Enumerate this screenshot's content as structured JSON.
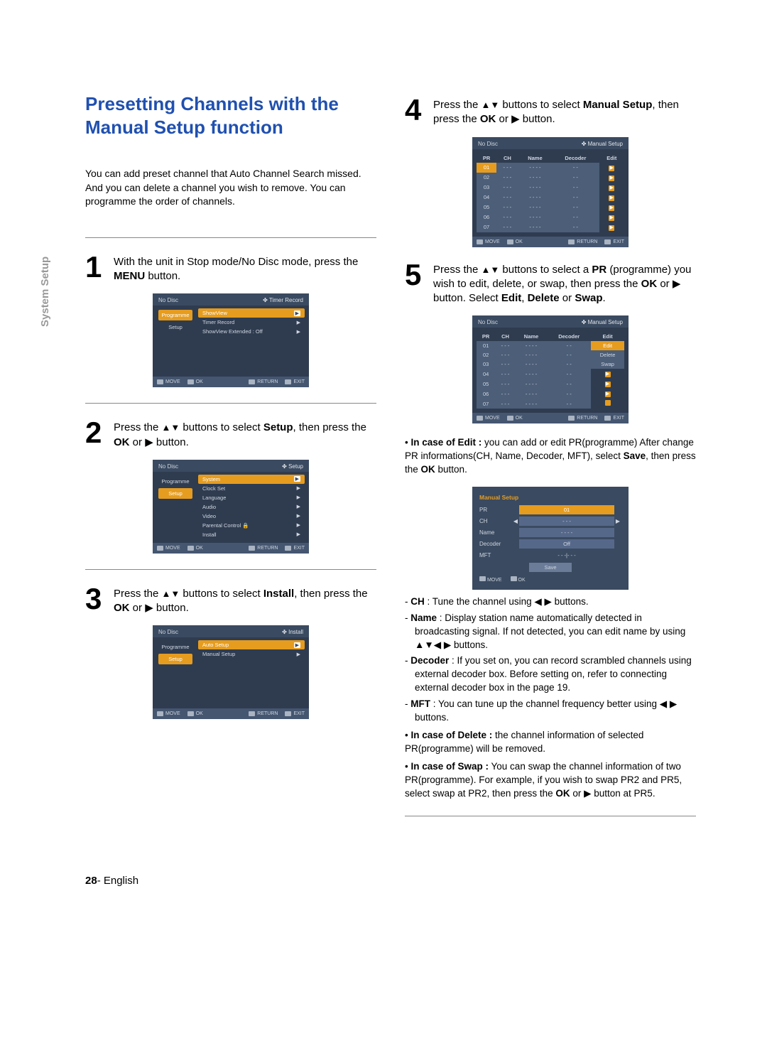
{
  "sideTab": "System Setup",
  "title": "Presetting Channels with the Manual Setup function",
  "intro": "You can add preset channel that Auto Channel Search missed. And you can delete a channel you wish to remove. You can programme the order of channels.",
  "steps": {
    "s1": {
      "num": "1",
      "pre": "With the unit in Stop mode/No Disc mode, press the ",
      "b1": "MENU",
      "post": " button."
    },
    "s2": {
      "num": "2",
      "pre": "Press the ",
      "arrows": "▲▼",
      "mid": " buttons to select ",
      "b1": "Setup",
      "mid2": ", then press the ",
      "b2": "OK",
      "or": " or ",
      "play": "▶",
      "post": " button."
    },
    "s3": {
      "num": "3",
      "pre": "Press the ",
      "arrows": "▲▼",
      "mid": " buttons to select ",
      "b1": "Install",
      "mid2": ", then press the ",
      "b2": "OK",
      "or": " or ",
      "play": "▶",
      "post": " button."
    },
    "s4": {
      "num": "4",
      "pre": "Press the ",
      "arrows": "▲▼",
      "mid": " buttons to select ",
      "b1": "Manual Setup",
      "mid2": ", then press the ",
      "b2": "OK",
      "or": " or ",
      "play": "▶",
      "post": " button."
    },
    "s5": {
      "num": "5",
      "pre": "Press the ",
      "arrows": "▲▼",
      "mid": " buttons to select a ",
      "b1": "PR",
      "mid2": " (programme) you wish to edit, delete, or swap, then press the ",
      "b2": "OK",
      "or": " or ",
      "play": "▶",
      "post": " button. Select ",
      "b3": "Edit",
      "c1": ", ",
      "b4": "Delete",
      "c2": " or ",
      "b5": "Swap",
      "c3": "."
    }
  },
  "osdCommon": {
    "nodisc": "No Disc",
    "footer": {
      "move": "MOVE",
      "ok": "OK",
      "return": "RETURN",
      "exit": "EXIT"
    },
    "leftTabs": {
      "programme": "Programme",
      "setup": "Setup"
    }
  },
  "osd1": {
    "crumb": "✤  Timer Record",
    "items": [
      "ShowView",
      "Timer Record",
      "ShowView Extended : Off"
    ]
  },
  "osd2": {
    "crumb": "✤  Setup",
    "items": [
      "System",
      "Clock Set",
      "Language",
      "Audio",
      "Video",
      "Parental Control  🔒",
      "Install"
    ]
  },
  "osd3": {
    "crumb": "✤  Install",
    "items": [
      "Auto Setup",
      "Manual Setup"
    ]
  },
  "osd4": {
    "crumb": "✤  Manual Setup",
    "headers": [
      "PR",
      "CH",
      "Name",
      "Decoder",
      "Edit"
    ],
    "rows": [
      [
        "01",
        "- - -",
        "- - - -",
        "- -",
        "▶"
      ],
      [
        "02",
        "- - -",
        "- - - -",
        "- -",
        "▶"
      ],
      [
        "03",
        "- - -",
        "- - - -",
        "- -",
        "▶"
      ],
      [
        "04",
        "- - -",
        "- - - -",
        "- -",
        "▶"
      ],
      [
        "05",
        "- - -",
        "- - - -",
        "- -",
        "▶"
      ],
      [
        "06",
        "- - -",
        "- - - -",
        "- -",
        "▶"
      ],
      [
        "07",
        "- - -",
        "- - - -",
        "- -",
        "▶"
      ]
    ]
  },
  "osd5": {
    "crumb": "✤  Manual Setup",
    "headers": [
      "PR",
      "CH",
      "Name",
      "Decoder",
      "Edit"
    ],
    "rows": [
      [
        "01",
        "- - -",
        "- - - -",
        "- -",
        "Edit"
      ],
      [
        "02",
        "- - -",
        "- - - -",
        "- -",
        "Delete"
      ],
      [
        "03",
        "- - -",
        "- - - -",
        "- -",
        "Swap"
      ],
      [
        "04",
        "- - -",
        "- - - -",
        "- -",
        "▶"
      ],
      [
        "05",
        "- - -",
        "- - - -",
        "- -",
        "▶"
      ],
      [
        "06",
        "- - -",
        "- - - -",
        "- -",
        "▶"
      ],
      [
        "07",
        "- - -",
        "- - - -",
        "- -",
        "▶"
      ]
    ]
  },
  "editNote": {
    "lead": "In case of Edit :",
    "body": " you can add or edit PR(programme) After change PR informations(CH, Name, Decoder, MFT), select ",
    "b1": "Save",
    "mid": ", then press the ",
    "b2": "OK",
    "post": " button."
  },
  "osdEdit": {
    "head": "Manual Setup",
    "rows": [
      {
        "lbl": "PR",
        "val": "01",
        "sel": true,
        "arrows": false
      },
      {
        "lbl": "CH",
        "val": "- - -",
        "sel": false,
        "arrows": true
      },
      {
        "lbl": "Name",
        "val": "- - - -",
        "sel": false,
        "arrows": false
      },
      {
        "lbl": "Decoder",
        "val": "Off",
        "sel": false,
        "arrows": false
      },
      {
        "lbl": "MFT",
        "val": "- - -|- - -",
        "sel": false,
        "arrows": false
      }
    ],
    "save": "Save",
    "foot": {
      "move": "MOVE",
      "ok": "OK"
    }
  },
  "descList": {
    "ch": {
      "t": "CH",
      "d": " : Tune the channel using ◀ ▶ buttons."
    },
    "name": {
      "t": "Name",
      "d": " : Display station name automatically detected in broadcasting signal. If not detected, you can edit name by using ▲▼◀ ▶ buttons."
    },
    "decoder": {
      "t": "Decoder",
      "d": " : If you set on, you can record scrambled channels using external decoder box. Before setting on, refer to connecting external decoder box in the page 19."
    },
    "mft": {
      "t": "MFT",
      "d": " : You can tune up the channel frequency better using ◀ ▶ buttons."
    }
  },
  "deleteNote": {
    "lead": "In case of Delete :",
    "body": " the channel information of selected PR(programme) will be removed."
  },
  "swapNote": {
    "lead": "In case of Swap :",
    "body": " You can swap the channel information of two PR(programme). For example, if you wish to swap PR2 and PR5,  select swap at PR2, then press the ",
    "b1": "OK",
    "mid": " or ▶ button at PR5."
  },
  "pageFooter": {
    "num": "28",
    "sep": "- ",
    "lang": "English"
  }
}
